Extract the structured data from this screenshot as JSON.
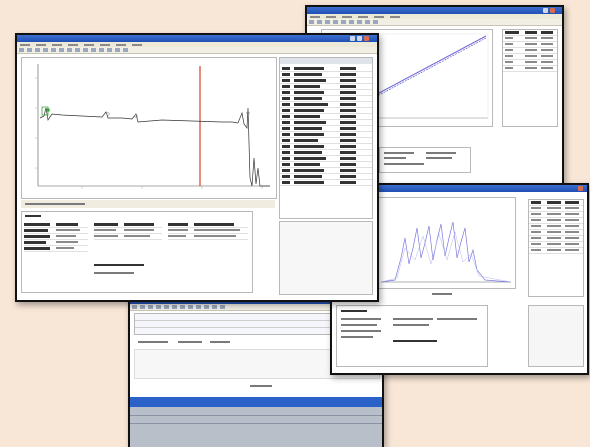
{
  "colors": {
    "background": "#f8e6d6",
    "title_bar": "#2a5bc4",
    "plot_red_marker": "#d8402a",
    "plot_blue": "#3a4fbf",
    "plot_purple": "#7a6ad8",
    "plot_green": "#3aa83a"
  },
  "windows": [
    {
      "id": "main-analysis-window",
      "title": ""
    },
    {
      "id": "calibration-window",
      "title": ""
    },
    {
      "id": "spectrum-window",
      "title": ""
    },
    {
      "id": "sequence-window",
      "title": ""
    }
  ],
  "icons": [
    "minimize-icon",
    "maximize-icon",
    "close-icon"
  ]
}
